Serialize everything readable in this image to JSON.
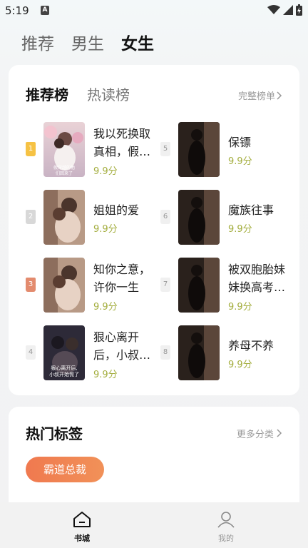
{
  "status": {
    "time": "5:19",
    "app_icon": "A"
  },
  "top_tabs": [
    {
      "label": "推荐",
      "active": false
    },
    {
      "label": "男生",
      "active": false
    },
    {
      "label": "女生",
      "active": true
    }
  ],
  "rank": {
    "tabs": [
      {
        "label": "推荐榜",
        "active": true
      },
      {
        "label": "热读榜",
        "active": false
      }
    ],
    "more": "完整榜单",
    "books": [
      {
        "rank": "1",
        "title": "我以死换取真相，假…",
        "score": "9.9分"
      },
      {
        "rank": "2",
        "title": "姐姐的爱",
        "score": "9.9分"
      },
      {
        "rank": "3",
        "title": "知你之意，许你一生",
        "score": "9.9分"
      },
      {
        "rank": "4",
        "title": "狠心离开后，小叔…",
        "score": "9.9分"
      },
      {
        "rank": "5",
        "title": "保镖",
        "score": "9.9分"
      },
      {
        "rank": "6",
        "title": "魔族往事",
        "score": "9.9分"
      },
      {
        "rank": "7",
        "title": "被双胞胎妹妹换高考…",
        "score": "9.9分"
      },
      {
        "rank": "8",
        "title": "养母不养",
        "score": "9.9分"
      }
    ],
    "cover_texts": {
      "book1": "假穿越的他们回来了",
      "book4": "狠心离开后，小叔开始慌了"
    }
  },
  "tags": {
    "title": "热门标签",
    "more": "更多分类",
    "chips": [
      "霸道总裁"
    ]
  },
  "nav": {
    "home": "书城",
    "me": "我的"
  },
  "colors": {
    "accent": "#f0794f",
    "score": "#a3ad3d",
    "gold": "#f6c244"
  }
}
